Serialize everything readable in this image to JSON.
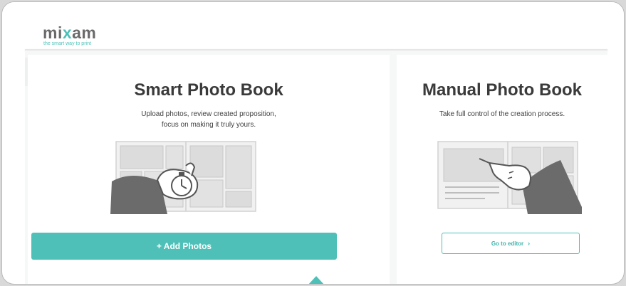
{
  "brand": {
    "logo_part1": "mi",
    "logo_part2": "x",
    "logo_part3": "am",
    "tagline": "the smart way to print",
    "accent_color": "#4fc0b8",
    "text_color": "#6a6a6a"
  },
  "smart_book": {
    "title": "Smart Photo Book",
    "description_line1": "Upload photos, review created proposition,",
    "description_line2": "focus on making it truly yours.",
    "button_label": "+ Add Photos",
    "illustration_icon": "hand-with-timer-photo-book-icon"
  },
  "manual_book": {
    "title": "Manual Photo Book",
    "description": "Take full control of the creation process.",
    "button_label": "Go to editor",
    "button_icon": "chevron-right-icon",
    "illustration_icon": "hand-pointing-photo-book-icon"
  }
}
